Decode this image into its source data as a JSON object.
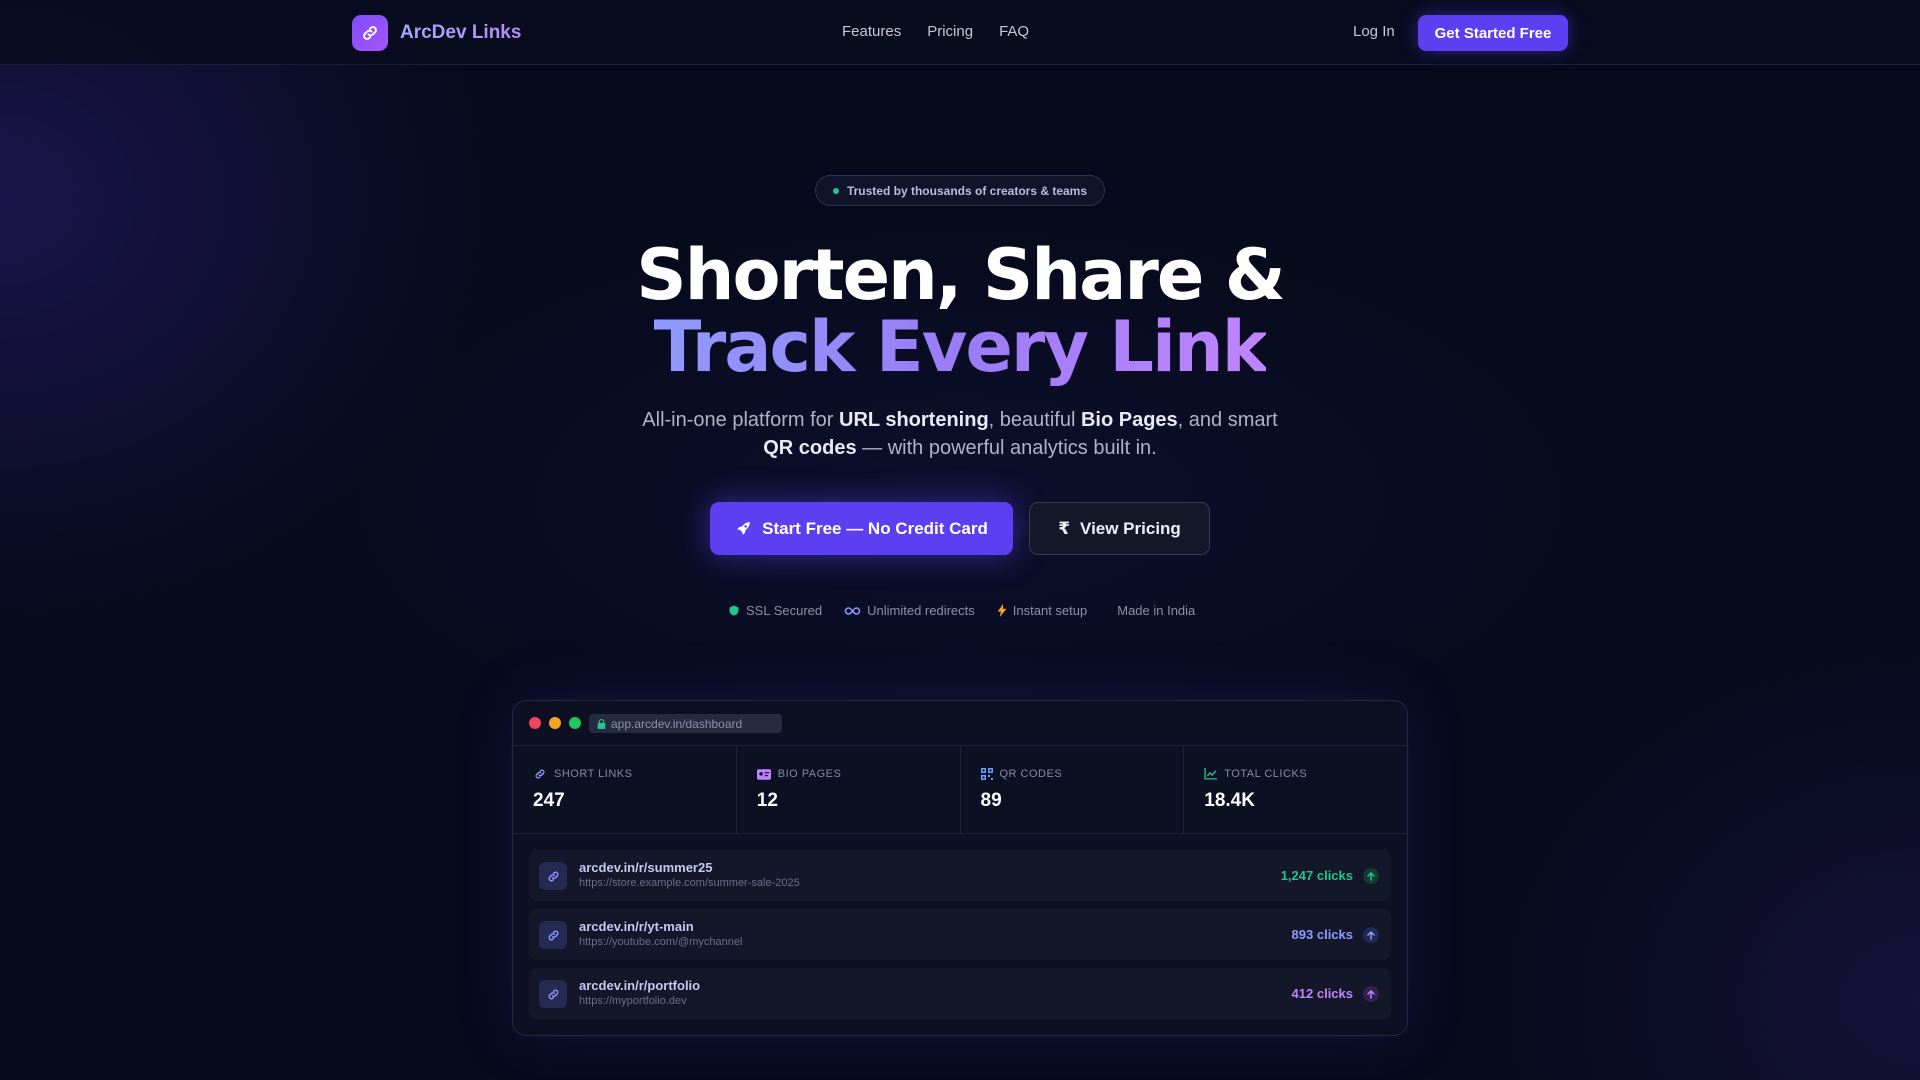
{
  "nav": {
    "brand": "ArcDev Links",
    "links": [
      "Features",
      "Pricing",
      "FAQ"
    ],
    "login": "Log In",
    "cta": "Get Started Free"
  },
  "hero": {
    "badge": "Trusted by thousands of creators & teams",
    "title_line1": "Shorten, Share &",
    "title_line2": "Track Every Link",
    "sub_1": "All-in-one platform for ",
    "sub_b1": "URL shortening",
    "sub_2": ", beautiful ",
    "sub_b2": "Bio Pages",
    "sub_3": ", and smart",
    "sub_b3": "QR codes",
    "sub_4": " — with powerful analytics built in.",
    "primary_cta": "Start Free — No Credit Card",
    "secondary_cta": "View Pricing",
    "trust": [
      {
        "label": "SSL Secured",
        "icon": "shield-icon"
      },
      {
        "label": "Unlimited redirects",
        "icon": "infinity-icon"
      },
      {
        "label": "Instant setup",
        "icon": "lightning-icon"
      },
      {
        "label": "Made in India",
        "icon": ""
      }
    ]
  },
  "dashboard": {
    "url": "app.arcdev.in/dashboard",
    "stats": [
      {
        "label": "SHORT LINKS",
        "value": "247",
        "icon": "link-icon"
      },
      {
        "label": "BIO PAGES",
        "value": "12",
        "icon": "id-card-icon"
      },
      {
        "label": "QR CODES",
        "value": "89",
        "icon": "qr-icon"
      },
      {
        "label": "TOTAL CLICKS",
        "value": "18.4K",
        "icon": "chart-icon"
      }
    ],
    "links": [
      {
        "short": "arcdev.in/r/summer25",
        "long": "https://store.example.com/summer-sale-2025",
        "clicks": "1,247 clicks"
      },
      {
        "short": "arcdev.in/r/yt-main",
        "long": "https://youtube.com/@mychannel",
        "clicks": "893 clicks"
      },
      {
        "short": "arcdev.in/r/portfolio",
        "long": "https://myportfolio.dev",
        "clicks": "412 clicks"
      }
    ]
  },
  "colors": {
    "accent": "#5b3ff0",
    "background": "#070a1c",
    "green": "#22c58b",
    "indigo": "#8f9bff",
    "purple": "#c084fc"
  }
}
